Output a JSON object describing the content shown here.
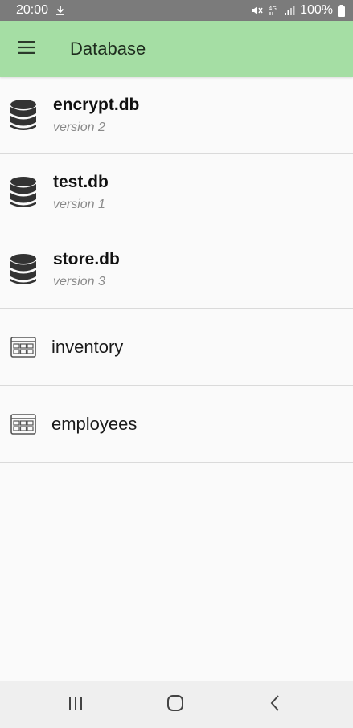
{
  "status_bar": {
    "time": "20:00",
    "battery": "100%",
    "icons": [
      "download-icon",
      "mute-icon",
      "4g-icon",
      "signal-icon",
      "battery-icon"
    ]
  },
  "app_bar": {
    "title": "Database",
    "background": "#a5dea4"
  },
  "databases": [
    {
      "name": "encrypt.db",
      "version": "version 2"
    },
    {
      "name": "test.db",
      "version": "version 1"
    },
    {
      "name": "store.db",
      "version": "version 3"
    }
  ],
  "tables": [
    {
      "name": "inventory"
    },
    {
      "name": "employees"
    }
  ],
  "nav_bar": {
    "buttons": [
      "recents-icon",
      "home-icon",
      "back-icon"
    ]
  }
}
